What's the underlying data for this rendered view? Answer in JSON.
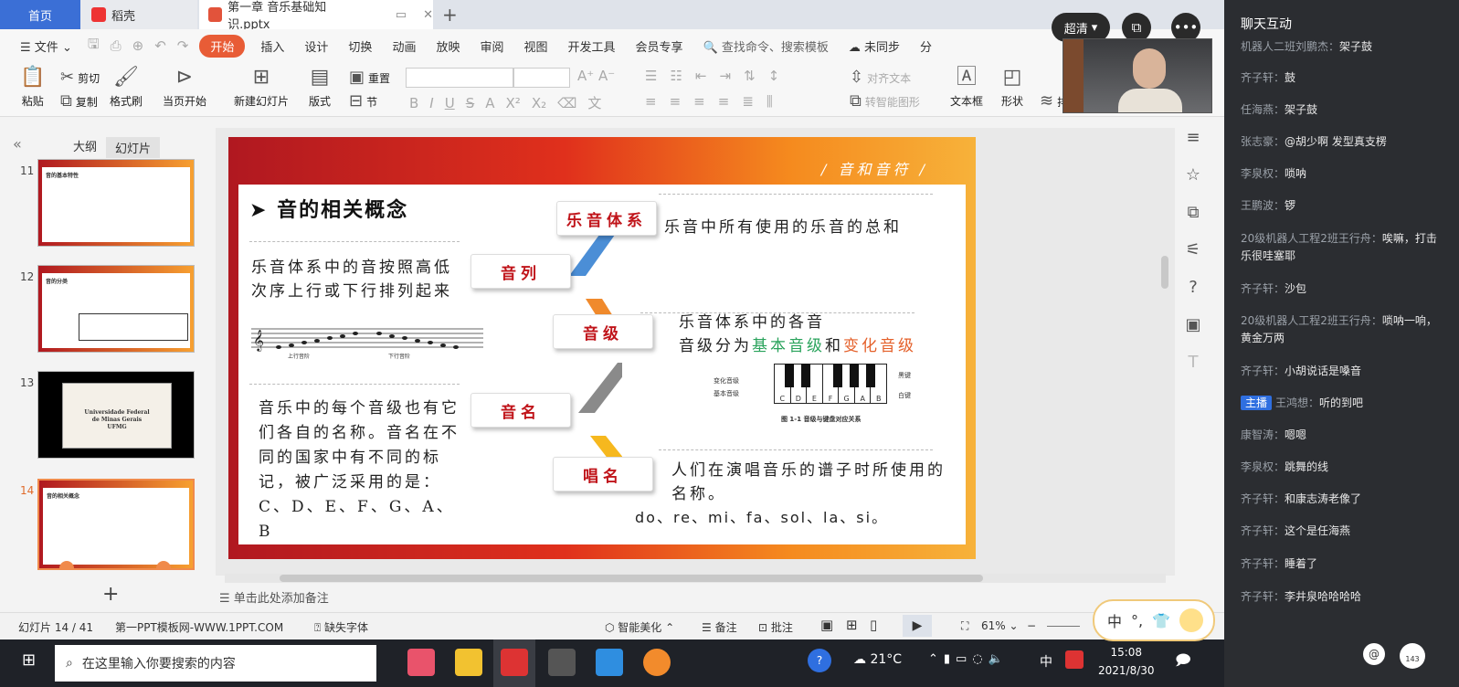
{
  "tabs": {
    "home": "首页",
    "daoke": "稻壳",
    "doc": "第一章 音乐基础知识.pptx",
    "add": "+"
  },
  "menu": {
    "file": "文件",
    "items": [
      "开始",
      "插入",
      "设计",
      "切换",
      "动画",
      "放映",
      "审阅",
      "视图",
      "开发工具",
      "会员专享"
    ],
    "active": "开始",
    "search": "查找命令、搜索模板",
    "sync": "未同步",
    "share": "分"
  },
  "ribbon": {
    "paste": "粘贴",
    "cut": "剪切",
    "copy": "复制",
    "format_painter": "格式刷",
    "from_current": "当页开始",
    "new_slide": "新建幻灯片",
    "layout": "版式",
    "reset": "重置",
    "section": "节",
    "align_text": "对齐文本",
    "to_smartart": "转智能图形",
    "textbox": "文本框",
    "shape": "形状",
    "more": "排"
  },
  "left_pane": {
    "tab_outline": "大纲",
    "tab_slides": "幻灯片",
    "nums": [
      "11",
      "12",
      "13",
      "14"
    ],
    "add": "+"
  },
  "thumb": {
    "t11": "音的基本特性",
    "t12": "音的分类",
    "t13_l1": "Universidade Federal",
    "t13_l2": "de Minas Gerais",
    "t13_l3": "UFMG",
    "t14": "音的相关概念"
  },
  "slide": {
    "tag": "/ 音和音符 /",
    "title": "音的相关概念",
    "b1": "乐音体系",
    "b2": "音列",
    "b3": "音级",
    "b4": "音名",
    "b5": "唱名",
    "d1": "乐音中所有使用的乐音的总和",
    "d2": "乐音体系中的音按照高低次序上行或下行排列起来",
    "d3a": "乐音体系中的各音",
    "d3b": "音级分为",
    "d3c": "基本音级",
    "d3d": "和",
    "d3e": "变化音级",
    "d4": "音乐中的每个音级也有它们各自的名称。音名在不同的国家中有不同的标记，被广泛采用的是：C、D、E、F、G、A、B",
    "d5": "人们在演唱音乐的谱子时所使用的名称。",
    "d5b": "do、re、mi、fa、sol、la、si。",
    "staff_up": "上行音阶",
    "staff_down": "下行音阶",
    "piano_black": "黑键",
    "piano_white": "白键",
    "piano_change": "变化音级",
    "piano_basic": "基本音级",
    "piano_keys": [
      "C",
      "D",
      "E",
      "F",
      "G",
      "A",
      "B"
    ],
    "piano_caption": "图 1-1  音级与键盘对应关系"
  },
  "notes": "单击此处添加备注",
  "status": {
    "slide": "幻灯片 14 / 41",
    "template": "第一PPT模板网-WWW.1PPT.COM",
    "missing_font": "缺失字体",
    "beautify": "智能美化",
    "note": "备注",
    "comment": "批注",
    "zoom": "61%"
  },
  "taskbar": {
    "search": "在这里输入你要搜索的内容",
    "temp": "21°C",
    "ime": "中",
    "time": "15:08",
    "date": "2021/8/30"
  },
  "overlay": {
    "quality": "超清"
  },
  "ime_widget": "中",
  "chat": {
    "title": "聊天互动",
    "messages": [
      {
        "who": "机器人二班刘鹏杰：",
        "text": "架子鼓"
      },
      {
        "who": "齐子轩：",
        "text": "鼓"
      },
      {
        "who": "任海燕：",
        "text": "架子鼓"
      },
      {
        "who": "张志豪：",
        "text": "@胡少啊 发型真支楞"
      },
      {
        "who": "李泉权：",
        "text": "唢呐"
      },
      {
        "who": "王鹏波：",
        "text": "锣"
      },
      {
        "who": "20级机器人工程2班王行舟：",
        "text": "唉嘛，打击乐很哇塞耶"
      },
      {
        "who": "齐子轩：",
        "text": "沙包"
      },
      {
        "who": "20级机器人工程2班王行舟：",
        "text": "唢呐一响，黄金万两"
      },
      {
        "who": "齐子轩：",
        "text": "小胡说话是嗓音"
      },
      {
        "who": "王鸿想：",
        "text": "听的到吧",
        "host": "主播"
      },
      {
        "who": "康智涛：",
        "text": "嗯嗯"
      },
      {
        "who": "李泉权：",
        "text": "跳舞的线"
      },
      {
        "who": "齐子轩：",
        "text": "和康志涛老像了"
      },
      {
        "who": "齐子轩：",
        "text": "这个是任海燕"
      },
      {
        "who": "齐子轩：",
        "text": "睡着了"
      },
      {
        "who": "齐子轩：",
        "text": "李井泉哈哈哈哈"
      }
    ],
    "badge": "143"
  }
}
